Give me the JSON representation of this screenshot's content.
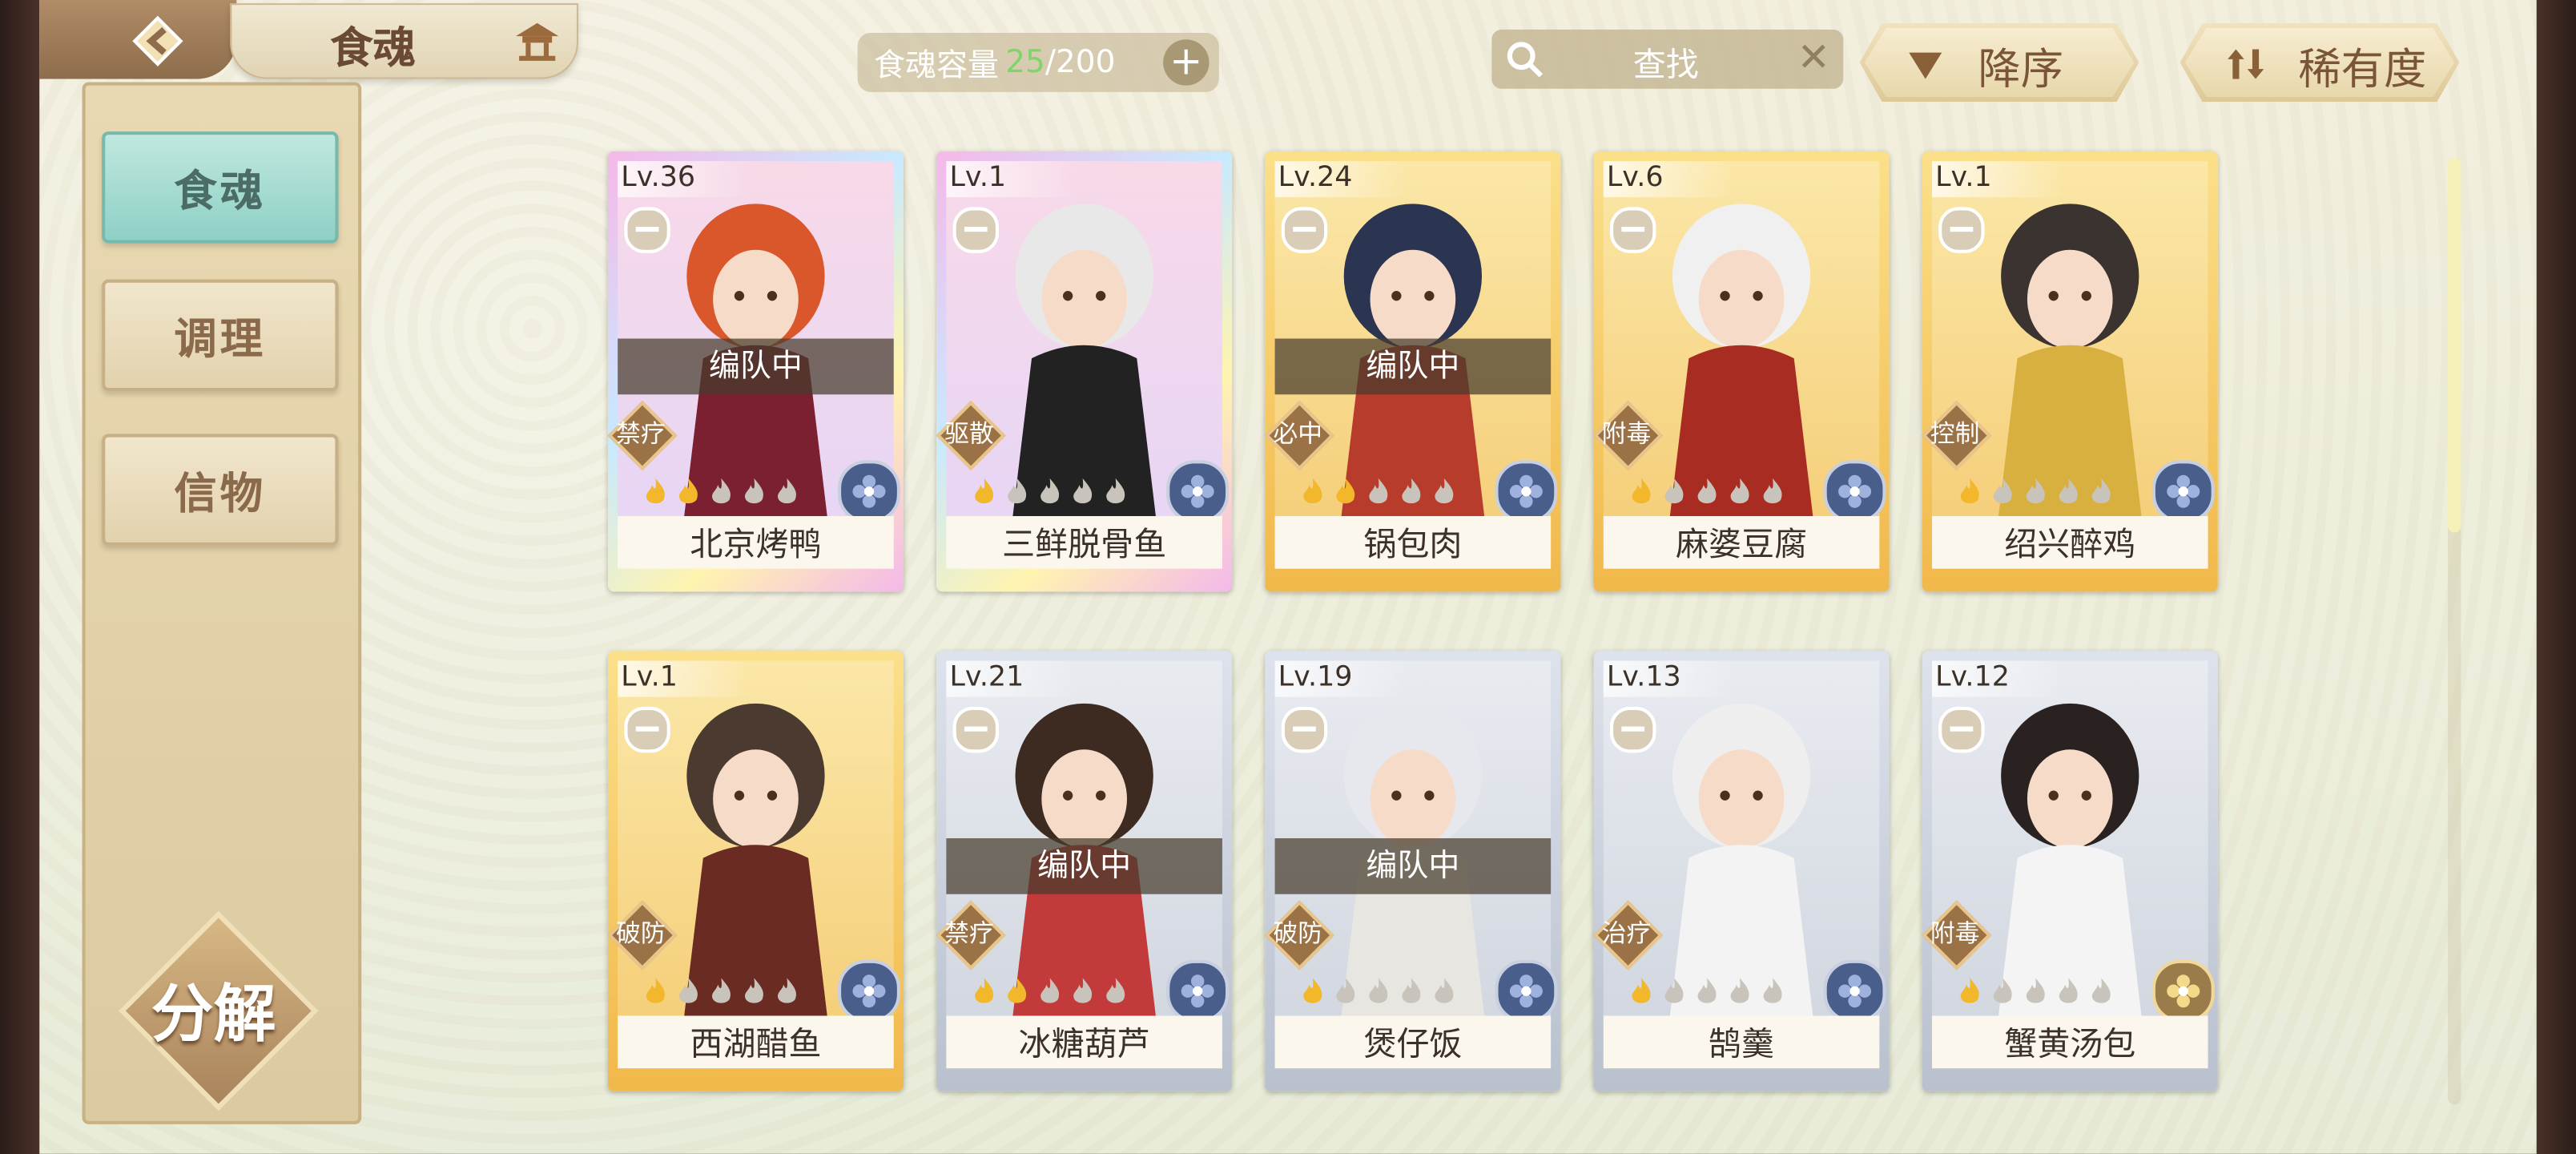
{
  "header": {
    "title": "食魂",
    "capacity_label": "食魂容量",
    "capacity_current": "25",
    "capacity_sep": "/",
    "capacity_max": "200",
    "capacity_add": "+",
    "search_placeholder": "查找",
    "search_clear": "✕",
    "sort_order": "降序",
    "sort_key": "稀有度"
  },
  "nav": {
    "items": [
      {
        "label": "食魂",
        "active": true
      },
      {
        "label": "调理",
        "active": false
      },
      {
        "label": "信物",
        "active": false
      }
    ],
    "decompose": "分解"
  },
  "colors": {
    "rainbow": "#e9c9f0",
    "gold": "#f5c85a",
    "silver": "#c6ccd8",
    "nav_active": "#9ed8cd"
  },
  "cards": [
    {
      "level": "Lv.36",
      "name": "北京烤鸭",
      "role": "禁疗",
      "team": "编队中",
      "rarity": "rainbow",
      "stars": 2,
      "element": "blue"
    },
    {
      "level": "Lv.1",
      "name": "三鲜脱骨鱼",
      "role": "驱散",
      "team": "",
      "rarity": "rainbow",
      "stars": 1,
      "element": "blue"
    },
    {
      "level": "Lv.24",
      "name": "锅包肉",
      "role": "必中",
      "team": "编队中",
      "rarity": "gold",
      "stars": 2,
      "element": "blue"
    },
    {
      "level": "Lv.6",
      "name": "麻婆豆腐",
      "role": "附毒",
      "team": "",
      "rarity": "gold",
      "stars": 1,
      "element": "blue"
    },
    {
      "level": "Lv.1",
      "name": "绍兴醉鸡",
      "role": "控制",
      "team": "",
      "rarity": "gold",
      "stars": 1,
      "element": "blue"
    },
    {
      "level": "Lv.1",
      "name": "西湖醋鱼",
      "role": "破防",
      "team": "",
      "rarity": "gold",
      "stars": 1,
      "element": "blue"
    },
    {
      "level": "Lv.21",
      "name": "冰糖葫芦",
      "role": "禁疗",
      "team": "编队中",
      "rarity": "silver",
      "stars": 2,
      "element": "blue"
    },
    {
      "level": "Lv.19",
      "name": "煲仔饭",
      "role": "破防",
      "team": "编队中",
      "rarity": "silver",
      "stars": 1,
      "element": "blue"
    },
    {
      "level": "Lv.13",
      "name": "鹄羹",
      "role": "治疗",
      "team": "",
      "rarity": "silver",
      "stars": 1,
      "element": "blue"
    },
    {
      "level": "Lv.12",
      "name": "蟹黄汤包",
      "role": "附毒",
      "team": "",
      "rarity": "silver",
      "stars": 1,
      "element": "gold"
    }
  ]
}
